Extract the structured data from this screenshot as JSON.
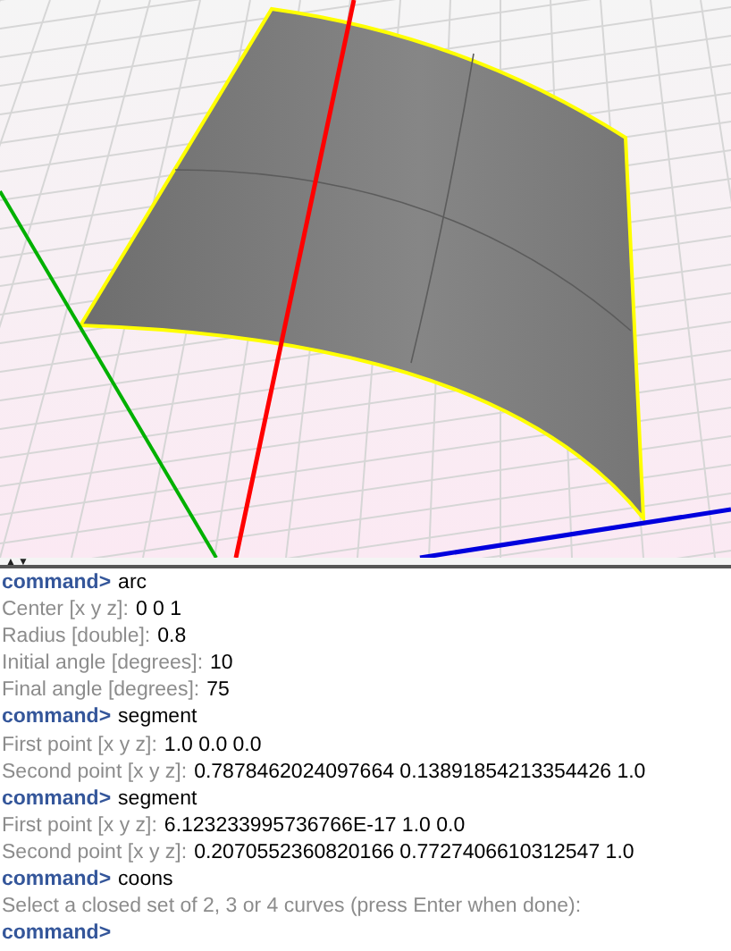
{
  "splitter": {
    "up": "▲",
    "down": "▼"
  },
  "console": [
    {
      "kind": "command",
      "prompt": "command>",
      "text": "arc"
    },
    {
      "kind": "input",
      "label": "Center [x y z]:",
      "value": "0 0 1"
    },
    {
      "kind": "input",
      "label": "Radius [double]:",
      "value": "0.8"
    },
    {
      "kind": "input",
      "label": "Initial angle [degrees]:",
      "value": "10"
    },
    {
      "kind": "input",
      "label": "Final angle [degrees]:",
      "value": "75"
    },
    {
      "kind": "command",
      "prompt": "command>",
      "text": "segment"
    },
    {
      "kind": "input",
      "label": "First point [x y z]:",
      "value": "1.0 0.0 0.0"
    },
    {
      "kind": "input",
      "label": "Second point [x y z]:",
      "value": "0.7878462024097664 0.13891854213354426 1.0"
    },
    {
      "kind": "command",
      "prompt": "command>",
      "text": "segment"
    },
    {
      "kind": "input",
      "label": "First point [x y z]:",
      "value": "6.123233995736766E-17 1.0 0.0"
    },
    {
      "kind": "input",
      "label": "Second point [x y z]:",
      "value": "0.2070552360820166 0.7727406610312547 1.0"
    },
    {
      "kind": "command",
      "prompt": "command>",
      "text": "coons"
    },
    {
      "kind": "message",
      "text": "Select a closed set of 2, 3 or 4 curves (press Enter when done):"
    },
    {
      "kind": "command",
      "prompt": "command>"
    }
  ]
}
